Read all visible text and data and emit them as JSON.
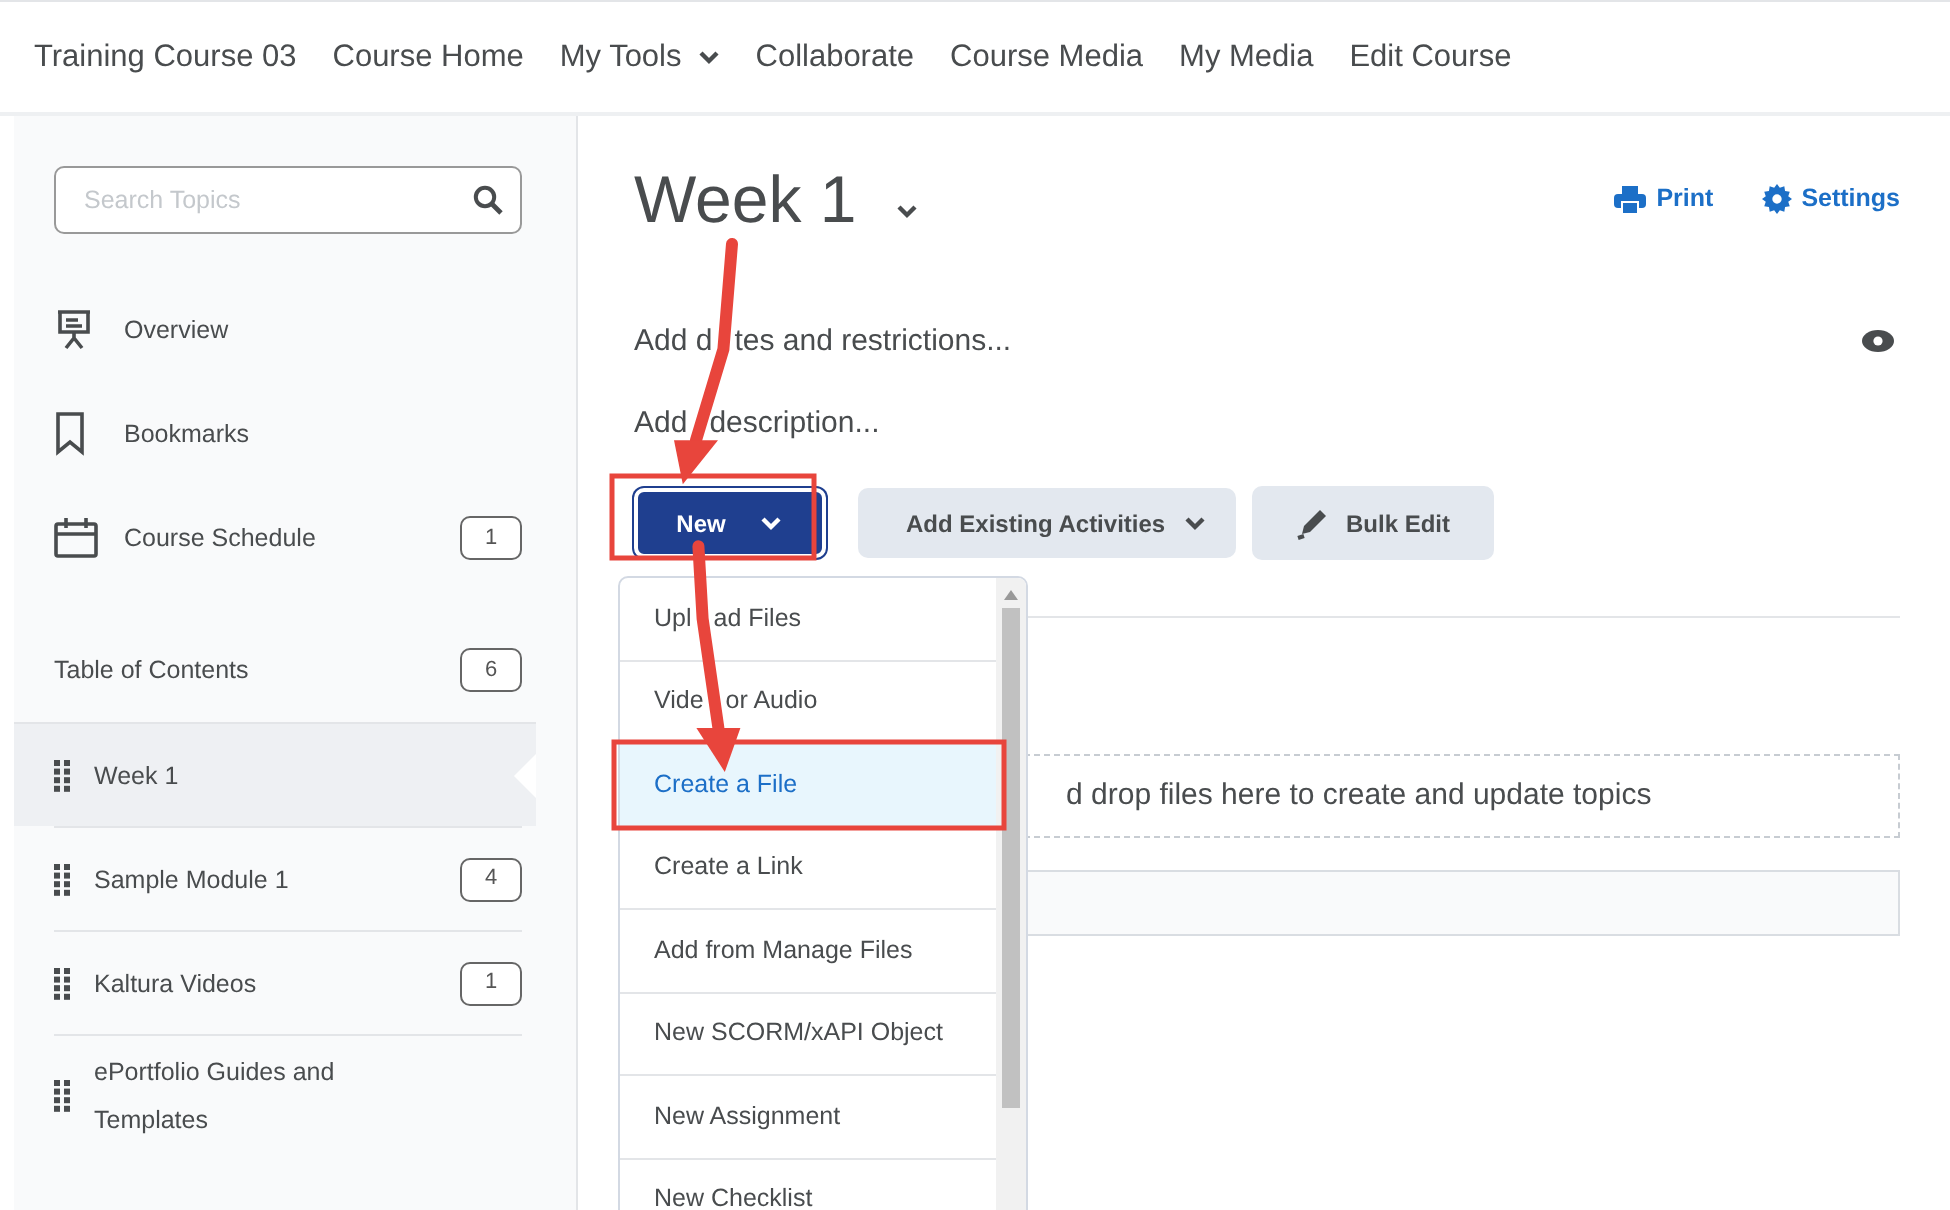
{
  "navbar": {
    "items": [
      {
        "label": "Training Course 03",
        "dropdown": false
      },
      {
        "label": "Course Home",
        "dropdown": false
      },
      {
        "label": "My Tools",
        "dropdown": true
      },
      {
        "label": "Collaborate",
        "dropdown": false
      },
      {
        "label": "Course Media",
        "dropdown": false
      },
      {
        "label": "My Media",
        "dropdown": false
      },
      {
        "label": "Edit Course",
        "dropdown": false
      }
    ]
  },
  "sidebar": {
    "search": {
      "placeholder": "Search Topics"
    },
    "links": [
      {
        "kind": "overview",
        "label": "Overview"
      },
      {
        "kind": "bookmarks",
        "label": "Bookmarks"
      },
      {
        "kind": "schedule",
        "label": "Course Schedule",
        "count": "1"
      }
    ],
    "toc": {
      "label": "Table of Contents",
      "count": "6"
    },
    "modules": [
      {
        "label": "Week 1",
        "selected": true
      },
      {
        "label": "Sample Module 1",
        "count": "4",
        "selected": false
      },
      {
        "label": "Kaltura Videos",
        "count": "1",
        "selected": false
      },
      {
        "label": "ePortfolio Guides and Templates",
        "selected": false
      }
    ]
  },
  "main": {
    "title": "Week 1",
    "actions": [
      {
        "kind": "print",
        "label": "Print"
      },
      {
        "kind": "settings",
        "label": "Settings"
      }
    ],
    "dates_link": [
      "Add d",
      "tes and restrictions..."
    ],
    "description_link": [
      "Add",
      "description..."
    ],
    "buttons": [
      {
        "kind": "primary",
        "label": "New"
      },
      {
        "kind": "dropdown",
        "label": "Add Existing Activities"
      },
      {
        "kind": "bulk",
        "label": "Bulk Edit"
      }
    ],
    "dropzone": "d drop files here to create and update topics",
    "new_menu": [
      {
        "label": [
          "Upl",
          "ad Files"
        ],
        "selected": false
      },
      {
        "label": [
          "Vide",
          "or Audio"
        ],
        "selected": false
      },
      {
        "label": "Create a File",
        "selected": true
      },
      {
        "label": "Create a Link",
        "selected": false
      },
      {
        "label": "Add from Manage Files",
        "selected": false
      },
      {
        "label": "New SCORM/xAPI Object",
        "selected": false
      },
      {
        "label": "New Assignment",
        "selected": false
      },
      {
        "label": "New Checklist",
        "selected": false
      }
    ]
  }
}
